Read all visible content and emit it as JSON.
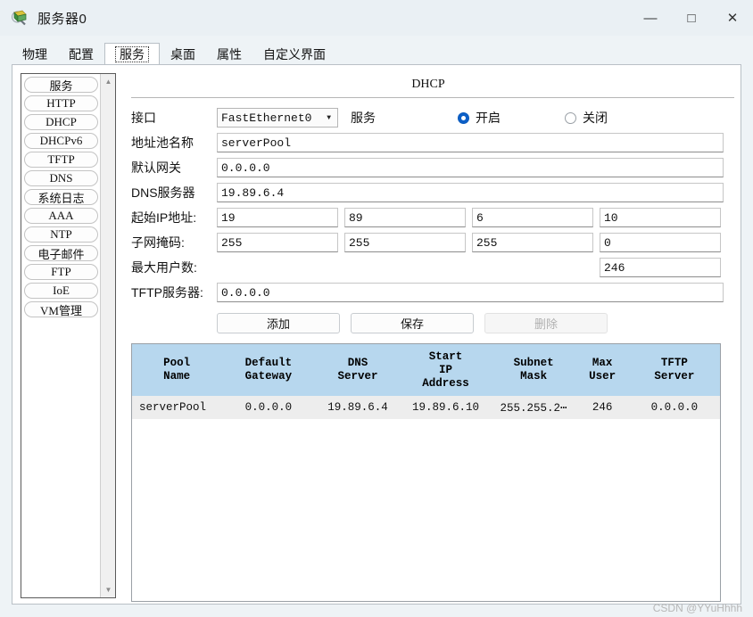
{
  "window": {
    "title": "服务器0",
    "icon": "server-magnifier-icon",
    "minimize": "—",
    "maximize": "□",
    "close": "✕"
  },
  "tabs": [
    {
      "label": "物理",
      "selected": false
    },
    {
      "label": "配置",
      "selected": false
    },
    {
      "label": "服务",
      "selected": true
    },
    {
      "label": "桌面",
      "selected": false
    },
    {
      "label": "属性",
      "selected": false
    },
    {
      "label": "自定义界面",
      "selected": false
    }
  ],
  "sidebar": {
    "items": [
      {
        "label": "服务"
      },
      {
        "label": "HTTP"
      },
      {
        "label": "DHCP"
      },
      {
        "label": "DHCPv6"
      },
      {
        "label": "TFTP"
      },
      {
        "label": "DNS"
      },
      {
        "label": "系统日志"
      },
      {
        "label": "AAA"
      },
      {
        "label": "NTP"
      },
      {
        "label": "电子邮件"
      },
      {
        "label": "FTP"
      },
      {
        "label": "IoE"
      },
      {
        "label": "VM管理"
      }
    ],
    "scroll_up": "▲",
    "scroll_down": "▼"
  },
  "pane": {
    "title": "DHCP",
    "labels": {
      "interface": "接口",
      "service": "服务",
      "pool_name": "地址池名称",
      "default_gateway": "默认网关",
      "dns_server": "DNS服务器",
      "start_ip": "起始IP地址:",
      "subnet_mask": "子网掩码:",
      "max_users": "最大用户数:",
      "tftp_server": "TFTP服务器:"
    },
    "interface_value": "FastEthernet0",
    "interface_caret": "▼",
    "service_on": {
      "label": "开启",
      "selected": true
    },
    "service_off": {
      "label": "关闭",
      "selected": false
    },
    "pool_name_value": "serverPool",
    "default_gateway_value": "0.0.0.0",
    "dns_server_value": "19.89.6.4",
    "start_ip_octets": [
      "19",
      "89",
      "6",
      "10"
    ],
    "subnet_mask_octets": [
      "255",
      "255",
      "255",
      "0"
    ],
    "max_users_value": "246",
    "tftp_server_value": "0.0.0.0",
    "buttons": {
      "add": "添加",
      "save": "保存",
      "delete": "删除",
      "delete_disabled": true
    }
  },
  "table": {
    "columns": [
      "Pool\nName",
      "Default\nGateway",
      "DNS\nServer",
      "Start\nIP\nAddress",
      "Subnet\nMask",
      "Max\nUser",
      "TFTP\nServer"
    ],
    "rows": [
      {
        "pool_name": "serverPool",
        "default_gateway": "0.0.0.0",
        "dns_server": "19.89.6.4",
        "start_ip_address": "19.89.6.10",
        "subnet_mask": "255.255.2⋯",
        "max_user": "246",
        "tftp_server": "0.0.0.0"
      }
    ]
  },
  "watermark": "CSDN @YYuHhhh",
  "colors": {
    "titlebar": "#eaf0f4",
    "table_header": "#b7d7ee",
    "table_row": "#ededed",
    "radio_accent": "#0c5fc7"
  }
}
